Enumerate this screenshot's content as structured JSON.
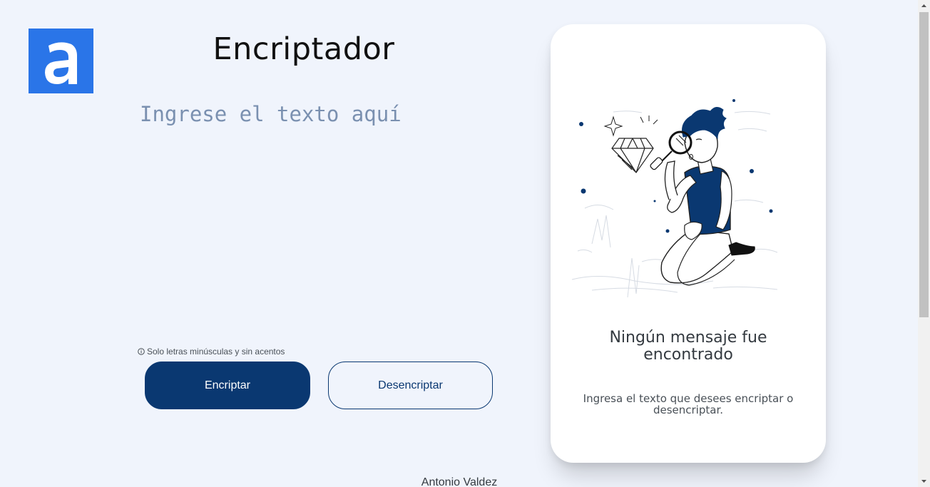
{
  "header": {
    "logo_letter": "a",
    "title": "Encriptador"
  },
  "input": {
    "placeholder": "Ingrese el texto aquí",
    "value": ""
  },
  "hint": {
    "icon": "info-circle-icon",
    "text": "Solo letras minúsculas y sin acentos"
  },
  "buttons": {
    "encrypt_label": "Encriptar",
    "decrypt_label": "Desencriptar"
  },
  "output": {
    "title": "Ningún mensaje fue encontrado",
    "text": "Ingresa el texto que desees encriptar o desencriptar."
  },
  "footer": {
    "author": "Antonio Valdez"
  },
  "colors": {
    "background": "#f0f4fc",
    "primary": "#0a3871",
    "logo": "#2a75e8",
    "card": "#ffffff"
  }
}
